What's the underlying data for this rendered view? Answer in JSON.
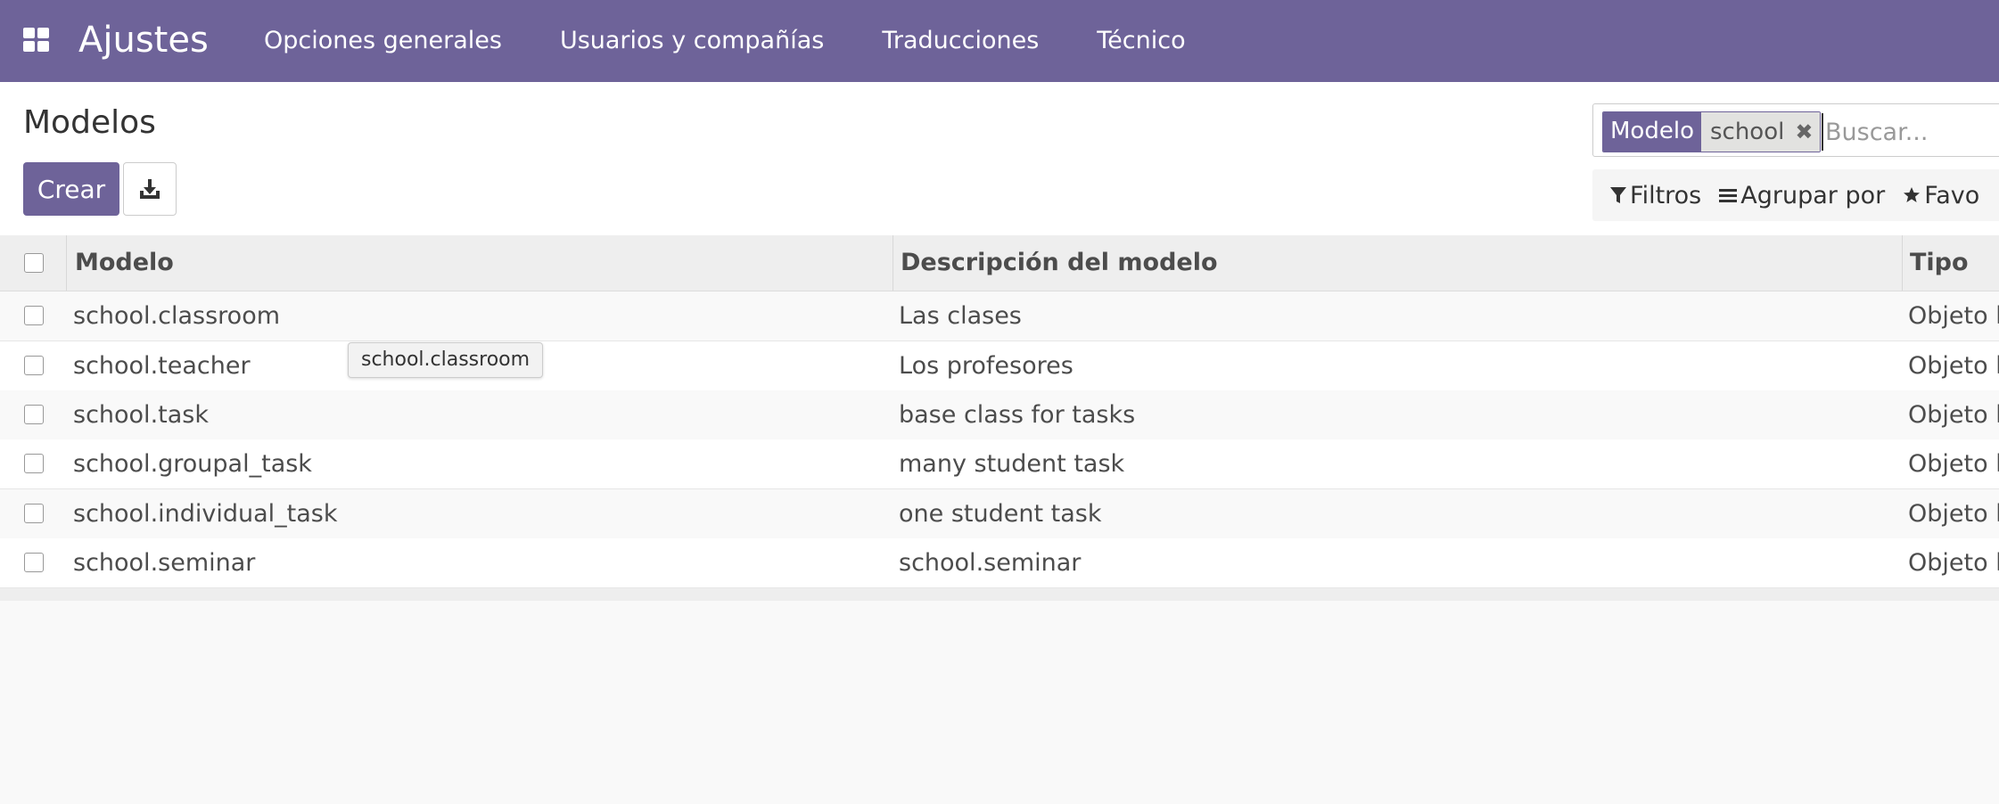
{
  "app": {
    "title": "Ajustes",
    "menu": [
      "Opciones generales",
      "Usuarios y compañías",
      "Traducciones",
      "Técnico"
    ]
  },
  "control_panel": {
    "title": "Modelos",
    "create_label": "Crear",
    "search": {
      "facet_label": "Modelo",
      "facet_value": "school",
      "placeholder": "Buscar..."
    },
    "options": {
      "filters": "Filtros",
      "group_by": "Agrupar por",
      "favorites": "Favo"
    }
  },
  "table": {
    "headers": [
      "Modelo",
      "Descripción del modelo",
      "Tipo"
    ],
    "rows": [
      {
        "model": "school.classroom",
        "description": "Las clases",
        "type": "Objeto b"
      },
      {
        "model": "school.teacher",
        "description": "Los profesores",
        "type": "Objeto b"
      },
      {
        "model": "school.task",
        "description": "base class for tasks",
        "type": "Objeto b"
      },
      {
        "model": "school.groupal_task",
        "description": "many student task",
        "type": "Objeto b"
      },
      {
        "model": "school.individual_task",
        "description": "one student task",
        "type": "Objeto b"
      },
      {
        "model": "school.seminar",
        "description": "school.seminar",
        "type": "Objeto b"
      }
    ]
  },
  "tooltip": {
    "text": "school.classroom"
  },
  "colors": {
    "brand": "#6e6399"
  }
}
